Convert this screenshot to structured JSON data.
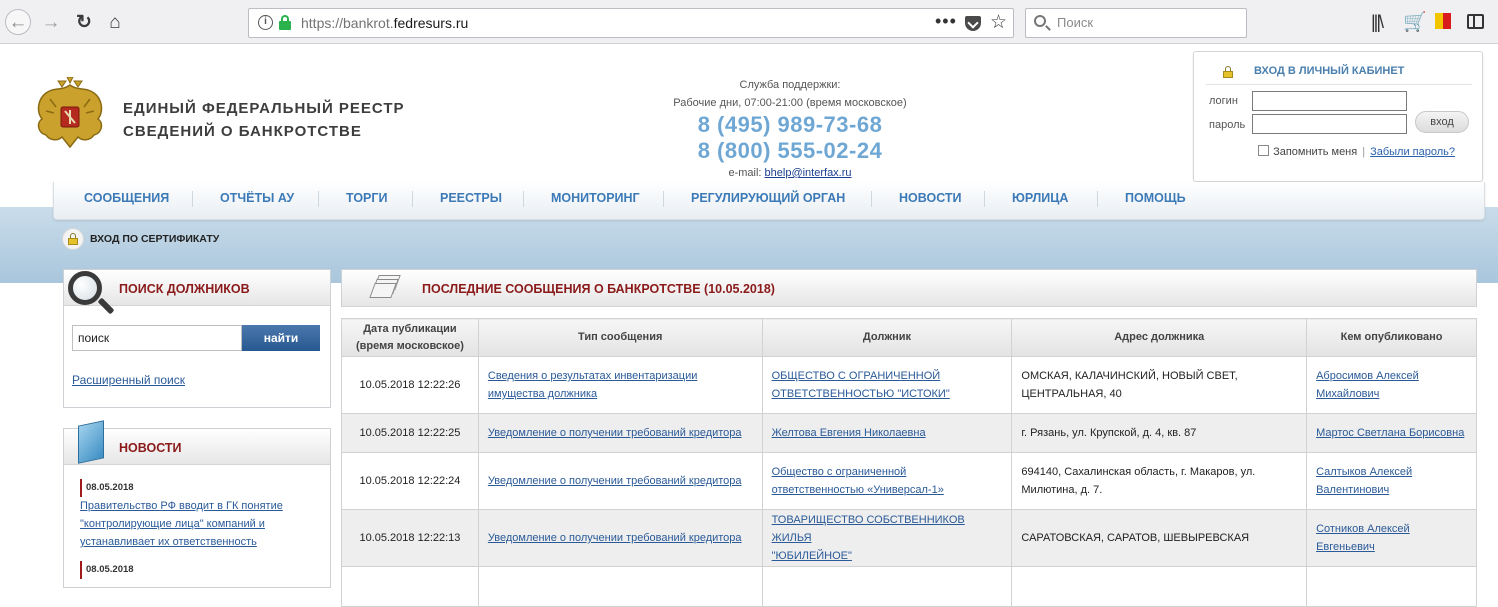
{
  "browser": {
    "url_scheme": "https://bankrot.",
    "url_host": "fedresurs.ru",
    "search_placeholder": "Поиск"
  },
  "header": {
    "title_line1": "ЕДИНЫЙ ФЕДЕРАЛЬНЫЙ РЕЕСТР",
    "title_line2": "СВЕДЕНИЙ О БАНКРОТСТВЕ"
  },
  "support": {
    "label": "Служба поддержки:",
    "hours": "Рабочие дни, 07:00-21:00 (время московское)",
    "phone1": "8 (495) 989-73-68",
    "phone2": "8 (800) 555-02-24",
    "email_label": "e-mail:",
    "email": "bhelp@interfax.ru"
  },
  "login": {
    "title": "ВХОД В ЛИЧНЫЙ КАБИНЕТ",
    "login_label": "логин",
    "password_label": "пароль",
    "submit": "вход",
    "remember": "Запомнить меня",
    "separator": "|",
    "forgot": "Забыли пароль?"
  },
  "nav": {
    "items": [
      "СООБЩЕНИЯ",
      "ОТЧЁТЫ АУ",
      "ТОРГИ",
      "РЕЕСТРЫ",
      "МОНИТОРИНГ",
      "РЕГУЛИРУЮЩИЙ ОРГАН",
      "НОВОСТИ",
      "ЮРЛИЦА",
      "ПОМОЩЬ"
    ]
  },
  "cert_login": "ВХОД ПО СЕРТИФИКАТУ",
  "debtor_search": {
    "title": "ПОИСК ДОЛЖНИКОВ",
    "input_value": "поиск",
    "button": "найти",
    "advanced": "Расширенный поиск"
  },
  "news": {
    "title": "НОВОСТИ",
    "items": [
      {
        "date": "08.05.2018",
        "line1": "Правительство РФ вводит в ГК понятие",
        "line2": "\"контролирующие лица\" компаний и",
        "line3": "устанавливает их ответственность"
      },
      {
        "date": "08.05.2018"
      }
    ]
  },
  "messages": {
    "title": "ПОСЛЕДНИЕ СООБЩЕНИЯ О БАНКРОТСТВЕ (10.05.2018)",
    "columns": [
      "Дата публикации",
      "(время московское)",
      "Тип сообщения",
      "Должник",
      "Адрес должника",
      "Кем опубликовано"
    ],
    "rows": [
      {
        "date": "10.05.2018 12:22:26",
        "type1": "Сведения о результатах инвентаризации",
        "type2": "имущества должника",
        "debtor1": "ОБЩЕСТВО С ОГРАНИЧЕННОЙ",
        "debtor2": "ОТВЕТСТВЕННОСТЬЮ \"ИСТОКИ\"",
        "addr1": "ОМСКАЯ, КАЛАЧИНСКИЙ, НОВЫЙ СВЕТ,",
        "addr2": "ЦЕНТРАЛЬНАЯ, 40",
        "pub1": "Абросимов Алексей",
        "pub2": "Михайлович"
      },
      {
        "date": "10.05.2018 12:22:25",
        "type1": "Уведомление о получении требований кредитора",
        "type2": "",
        "debtor1": "Желтова Евгения Николаевна",
        "debtor2": "",
        "addr1": "г. Рязань, ул. Крупской, д. 4, кв. 87",
        "addr2": "",
        "pub1": "Мартос Светлана Борисовна",
        "pub2": ""
      },
      {
        "date": "10.05.2018 12:22:24",
        "type1": "Уведомление о получении требований кредитора",
        "type2": "",
        "debtor1": "Общество с ограниченной",
        "debtor2": "ответственностью «Универсал-1»",
        "addr1": "694140, Сахалинская область, г. Макаров, ул.",
        "addr2": "Милютина, д. 7.",
        "pub1": "Салтыков Алексей",
        "pub2": "Валентинович"
      },
      {
        "date": "10.05.2018 12:22:13",
        "type1": "Уведомление о получении требований кредитора",
        "type2": "",
        "debtor1": "ТОВАРИЩЕСТВО СОБСТВЕННИКОВ ЖИЛЬЯ",
        "debtor2": "\"ЮБИЛЕЙНОЕ\"",
        "addr1": "САРАТОВСКАЯ, САРАТОВ, ШЕВЫРЕВСКАЯ",
        "addr2": "",
        "pub1": "Сотников Алексей",
        "pub2": "Евгеньевич"
      }
    ]
  }
}
